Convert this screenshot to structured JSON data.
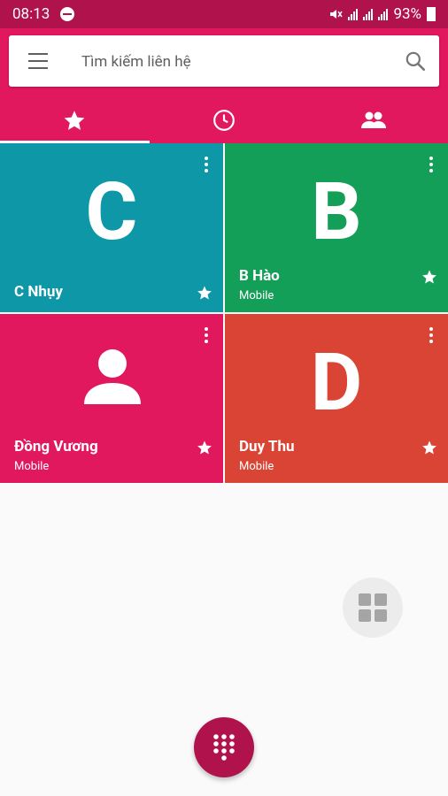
{
  "status_bar": {
    "time": "08:13",
    "battery": "93%"
  },
  "search": {
    "placeholder": "Tìm kiếm liên hệ"
  },
  "tabs": [
    {
      "icon": "star-icon",
      "active": true
    },
    {
      "icon": "clock-icon",
      "active": false
    },
    {
      "icon": "people-icon",
      "active": false
    }
  ],
  "favorites": [
    {
      "letter": "C",
      "name": "C Nhụy",
      "sub": "",
      "color": "#0e97a7"
    },
    {
      "letter": "B",
      "name": "B Hào",
      "sub": "Mobile",
      "color": "#149f59"
    },
    {
      "letter": "",
      "name": "Đồng Vương",
      "sub": "Mobile",
      "color": "#e2185f",
      "icon": "person-icon"
    },
    {
      "letter": "D",
      "name": "Duy Thu",
      "sub": "Mobile",
      "color": "#d94434"
    }
  ],
  "colors": {
    "status_bar": "#b0124b",
    "app_bar": "#e2185f",
    "background": "#fafafa",
    "dial_fab": "#b0124b"
  }
}
